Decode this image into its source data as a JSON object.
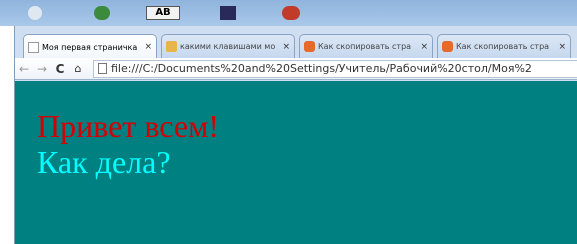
{
  "desktop": {
    "ab_icon_label": "AB"
  },
  "browser": {
    "tabs": [
      {
        "title": "Моя первая страничка",
        "close": "×",
        "active": true,
        "favicon": "page-icon"
      },
      {
        "title": "какими клавишами мо",
        "close": "×",
        "active": false,
        "favicon": "folder-icon"
      },
      {
        "title": "Как скопировать стра",
        "close": "×",
        "active": false,
        "favicon": "site-icon"
      },
      {
        "title": "Как скопировать стра",
        "close": "×",
        "active": false,
        "favicon": "site-icon"
      }
    ],
    "toolbar": {
      "back": "←",
      "forward": "→",
      "reload": "C",
      "home": "⌂",
      "url": "file:///C:/Documents%20and%20Settings/Учитель/Рабочий%20стол/Моя%2"
    }
  },
  "page": {
    "background": "#008080",
    "greeting": "Привет всем!",
    "greeting_color": "#d40000",
    "question": "Как дела?",
    "question_color": "#00ffff"
  }
}
